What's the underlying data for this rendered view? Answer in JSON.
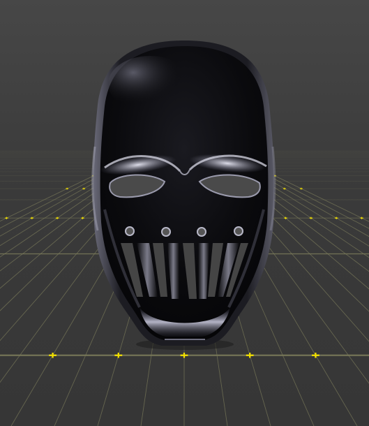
{
  "viewport": {
    "type": "3d-model-preview",
    "model": "mask",
    "background_color": "#3d3d3d",
    "floor_grid": true,
    "grid_line_color": "#7a7a5a",
    "grid_cross_color": "#f2e000"
  },
  "model": {
    "base_color": "#0b0b0e",
    "highlight_color": "#d8d8e6",
    "features": [
      "eye-holes",
      "mouth-slats",
      "vent-holes"
    ]
  }
}
